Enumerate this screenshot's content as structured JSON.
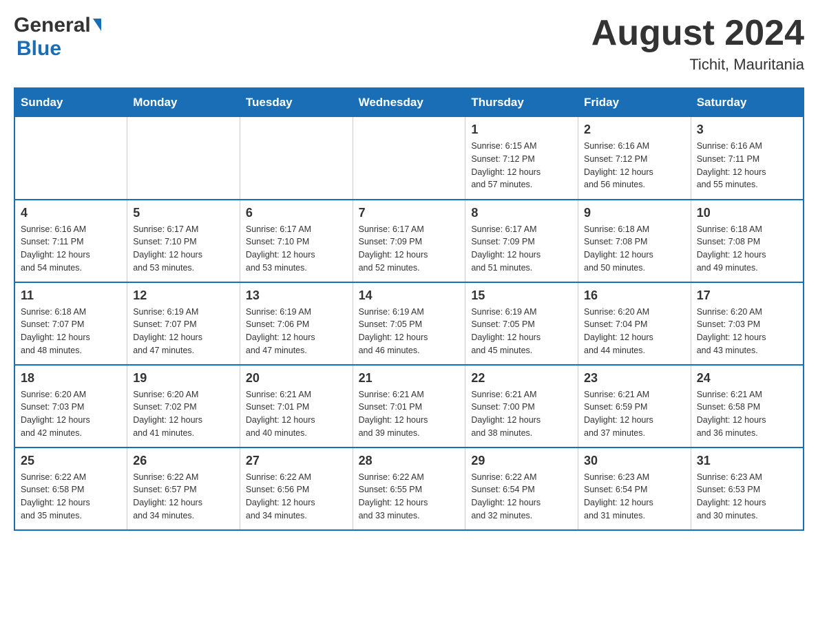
{
  "header": {
    "logo_general": "General",
    "logo_blue": "Blue",
    "month_title": "August 2024",
    "location": "Tichit, Mauritania"
  },
  "weekdays": [
    "Sunday",
    "Monday",
    "Tuesday",
    "Wednesday",
    "Thursday",
    "Friday",
    "Saturday"
  ],
  "weeks": [
    [
      {
        "day": "",
        "info": ""
      },
      {
        "day": "",
        "info": ""
      },
      {
        "day": "",
        "info": ""
      },
      {
        "day": "",
        "info": ""
      },
      {
        "day": "1",
        "info": "Sunrise: 6:15 AM\nSunset: 7:12 PM\nDaylight: 12 hours\nand 57 minutes."
      },
      {
        "day": "2",
        "info": "Sunrise: 6:16 AM\nSunset: 7:12 PM\nDaylight: 12 hours\nand 56 minutes."
      },
      {
        "day": "3",
        "info": "Sunrise: 6:16 AM\nSunset: 7:11 PM\nDaylight: 12 hours\nand 55 minutes."
      }
    ],
    [
      {
        "day": "4",
        "info": "Sunrise: 6:16 AM\nSunset: 7:11 PM\nDaylight: 12 hours\nand 54 minutes."
      },
      {
        "day": "5",
        "info": "Sunrise: 6:17 AM\nSunset: 7:10 PM\nDaylight: 12 hours\nand 53 minutes."
      },
      {
        "day": "6",
        "info": "Sunrise: 6:17 AM\nSunset: 7:10 PM\nDaylight: 12 hours\nand 53 minutes."
      },
      {
        "day": "7",
        "info": "Sunrise: 6:17 AM\nSunset: 7:09 PM\nDaylight: 12 hours\nand 52 minutes."
      },
      {
        "day": "8",
        "info": "Sunrise: 6:17 AM\nSunset: 7:09 PM\nDaylight: 12 hours\nand 51 minutes."
      },
      {
        "day": "9",
        "info": "Sunrise: 6:18 AM\nSunset: 7:08 PM\nDaylight: 12 hours\nand 50 minutes."
      },
      {
        "day": "10",
        "info": "Sunrise: 6:18 AM\nSunset: 7:08 PM\nDaylight: 12 hours\nand 49 minutes."
      }
    ],
    [
      {
        "day": "11",
        "info": "Sunrise: 6:18 AM\nSunset: 7:07 PM\nDaylight: 12 hours\nand 48 minutes."
      },
      {
        "day": "12",
        "info": "Sunrise: 6:19 AM\nSunset: 7:07 PM\nDaylight: 12 hours\nand 47 minutes."
      },
      {
        "day": "13",
        "info": "Sunrise: 6:19 AM\nSunset: 7:06 PM\nDaylight: 12 hours\nand 47 minutes."
      },
      {
        "day": "14",
        "info": "Sunrise: 6:19 AM\nSunset: 7:05 PM\nDaylight: 12 hours\nand 46 minutes."
      },
      {
        "day": "15",
        "info": "Sunrise: 6:19 AM\nSunset: 7:05 PM\nDaylight: 12 hours\nand 45 minutes."
      },
      {
        "day": "16",
        "info": "Sunrise: 6:20 AM\nSunset: 7:04 PM\nDaylight: 12 hours\nand 44 minutes."
      },
      {
        "day": "17",
        "info": "Sunrise: 6:20 AM\nSunset: 7:03 PM\nDaylight: 12 hours\nand 43 minutes."
      }
    ],
    [
      {
        "day": "18",
        "info": "Sunrise: 6:20 AM\nSunset: 7:03 PM\nDaylight: 12 hours\nand 42 minutes."
      },
      {
        "day": "19",
        "info": "Sunrise: 6:20 AM\nSunset: 7:02 PM\nDaylight: 12 hours\nand 41 minutes."
      },
      {
        "day": "20",
        "info": "Sunrise: 6:21 AM\nSunset: 7:01 PM\nDaylight: 12 hours\nand 40 minutes."
      },
      {
        "day": "21",
        "info": "Sunrise: 6:21 AM\nSunset: 7:01 PM\nDaylight: 12 hours\nand 39 minutes."
      },
      {
        "day": "22",
        "info": "Sunrise: 6:21 AM\nSunset: 7:00 PM\nDaylight: 12 hours\nand 38 minutes."
      },
      {
        "day": "23",
        "info": "Sunrise: 6:21 AM\nSunset: 6:59 PM\nDaylight: 12 hours\nand 37 minutes."
      },
      {
        "day": "24",
        "info": "Sunrise: 6:21 AM\nSunset: 6:58 PM\nDaylight: 12 hours\nand 36 minutes."
      }
    ],
    [
      {
        "day": "25",
        "info": "Sunrise: 6:22 AM\nSunset: 6:58 PM\nDaylight: 12 hours\nand 35 minutes."
      },
      {
        "day": "26",
        "info": "Sunrise: 6:22 AM\nSunset: 6:57 PM\nDaylight: 12 hours\nand 34 minutes."
      },
      {
        "day": "27",
        "info": "Sunrise: 6:22 AM\nSunset: 6:56 PM\nDaylight: 12 hours\nand 34 minutes."
      },
      {
        "day": "28",
        "info": "Sunrise: 6:22 AM\nSunset: 6:55 PM\nDaylight: 12 hours\nand 33 minutes."
      },
      {
        "day": "29",
        "info": "Sunrise: 6:22 AM\nSunset: 6:54 PM\nDaylight: 12 hours\nand 32 minutes."
      },
      {
        "day": "30",
        "info": "Sunrise: 6:23 AM\nSunset: 6:54 PM\nDaylight: 12 hours\nand 31 minutes."
      },
      {
        "day": "31",
        "info": "Sunrise: 6:23 AM\nSunset: 6:53 PM\nDaylight: 12 hours\nand 30 minutes."
      }
    ]
  ]
}
